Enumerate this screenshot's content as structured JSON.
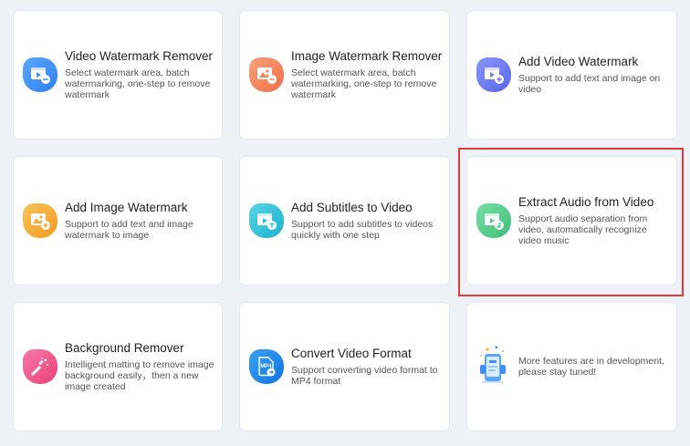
{
  "cards": [
    {
      "title": "Video Watermark Remover",
      "desc": "Select watermark area, batch watermarking, one-step to remove watermark",
      "icon": "video-eraser-icon",
      "color": "#3e8ef7"
    },
    {
      "title": "Image Watermark Remover",
      "desc": "Select watermark area, batch watermarking, one-step to remove watermark",
      "icon": "image-eraser-icon",
      "color": "#f5875a"
    },
    {
      "title": "Add Video Watermark",
      "desc": "Support to add text and image on video",
      "icon": "video-add-icon",
      "color": "#6b78f2"
    },
    {
      "title": "Add Image Watermark",
      "desc": "Support to add text and image watermark to image",
      "icon": "image-add-icon",
      "color": "#f7ad35"
    },
    {
      "title": "Add Subtitles to Video",
      "desc": "Support to add subtitles to videos quickly with one step",
      "icon": "subtitle-icon",
      "color": "#2fc3d9"
    },
    {
      "title": "Extract Audio from Video",
      "desc": "Support audio separation from video, automatically recognize video music",
      "icon": "audio-extract-icon",
      "color": "#4fcf8a"
    },
    {
      "title": "Background Remover",
      "desc": "Intelligent matting to remove image background easily，then a new image created",
      "icon": "magic-wand-icon",
      "color": "#f2508a"
    },
    {
      "title": "Convert Video Format",
      "desc": "Support converting video format to MP4 format",
      "icon": "mp4-file-icon",
      "color": "#1a8af0",
      "badge": "MP4"
    }
  ],
  "development": {
    "text": "More features are in development, please stay tuned!",
    "icon": "development-phone-icon"
  }
}
